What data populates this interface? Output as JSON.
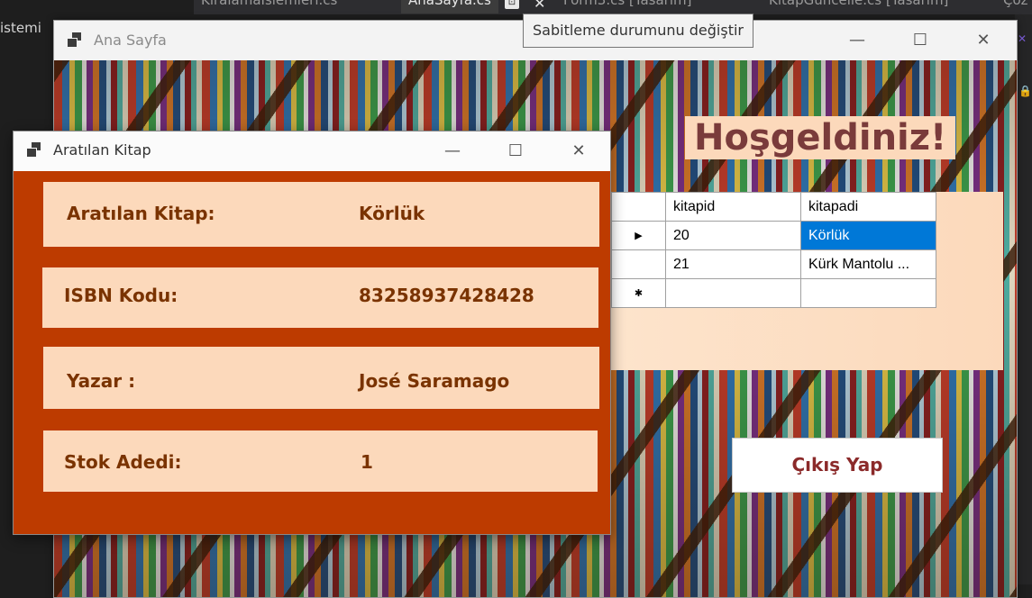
{
  "ide": {
    "sidebar_text": "istemi",
    "tabs": [
      {
        "label": "KiralamaIslemleri.cs"
      },
      {
        "label": "AnaSayfa.cs"
      },
      {
        "label": "Form3.cs [Tasarım]"
      },
      {
        "label": "KitapGuncelle.cs [Tasarım]"
      },
      {
        "label": "Çöz"
      }
    ],
    "tooltip": "Sabitleme durumunu değiştir"
  },
  "main_window": {
    "title": "Ana Sayfa",
    "welcome": "Hoşgeldiniz!",
    "grid": {
      "columns": [
        "kitapid",
        "kitapadi"
      ],
      "rows": [
        {
          "marker": "▶",
          "kitapid": "20",
          "kitapadi": "Körlük",
          "selected": true
        },
        {
          "marker": "",
          "kitapid": "21",
          "kitapadi": "Kürk Mantolu ...",
          "selected": false
        },
        {
          "marker": "✱",
          "kitapid": "",
          "kitapadi": "",
          "selected": false
        }
      ]
    },
    "exit_button": "Çıkış Yap"
  },
  "search_window": {
    "title": "Aratılan Kitap",
    "fields": [
      {
        "label": "Aratılan Kitap:",
        "value": "Körlük"
      },
      {
        "label": "ISBN Kodu:",
        "value": "83258937428428"
      },
      {
        "label": "Yazar :",
        "value": "José Saramago"
      },
      {
        "label": "Stok Adedi:",
        "value": "1"
      }
    ]
  },
  "colors": {
    "form_bg": "#bd3b00",
    "panel_bg": "#fcd9bb",
    "label_text": "#7a3300",
    "selection": "#0078d7"
  }
}
